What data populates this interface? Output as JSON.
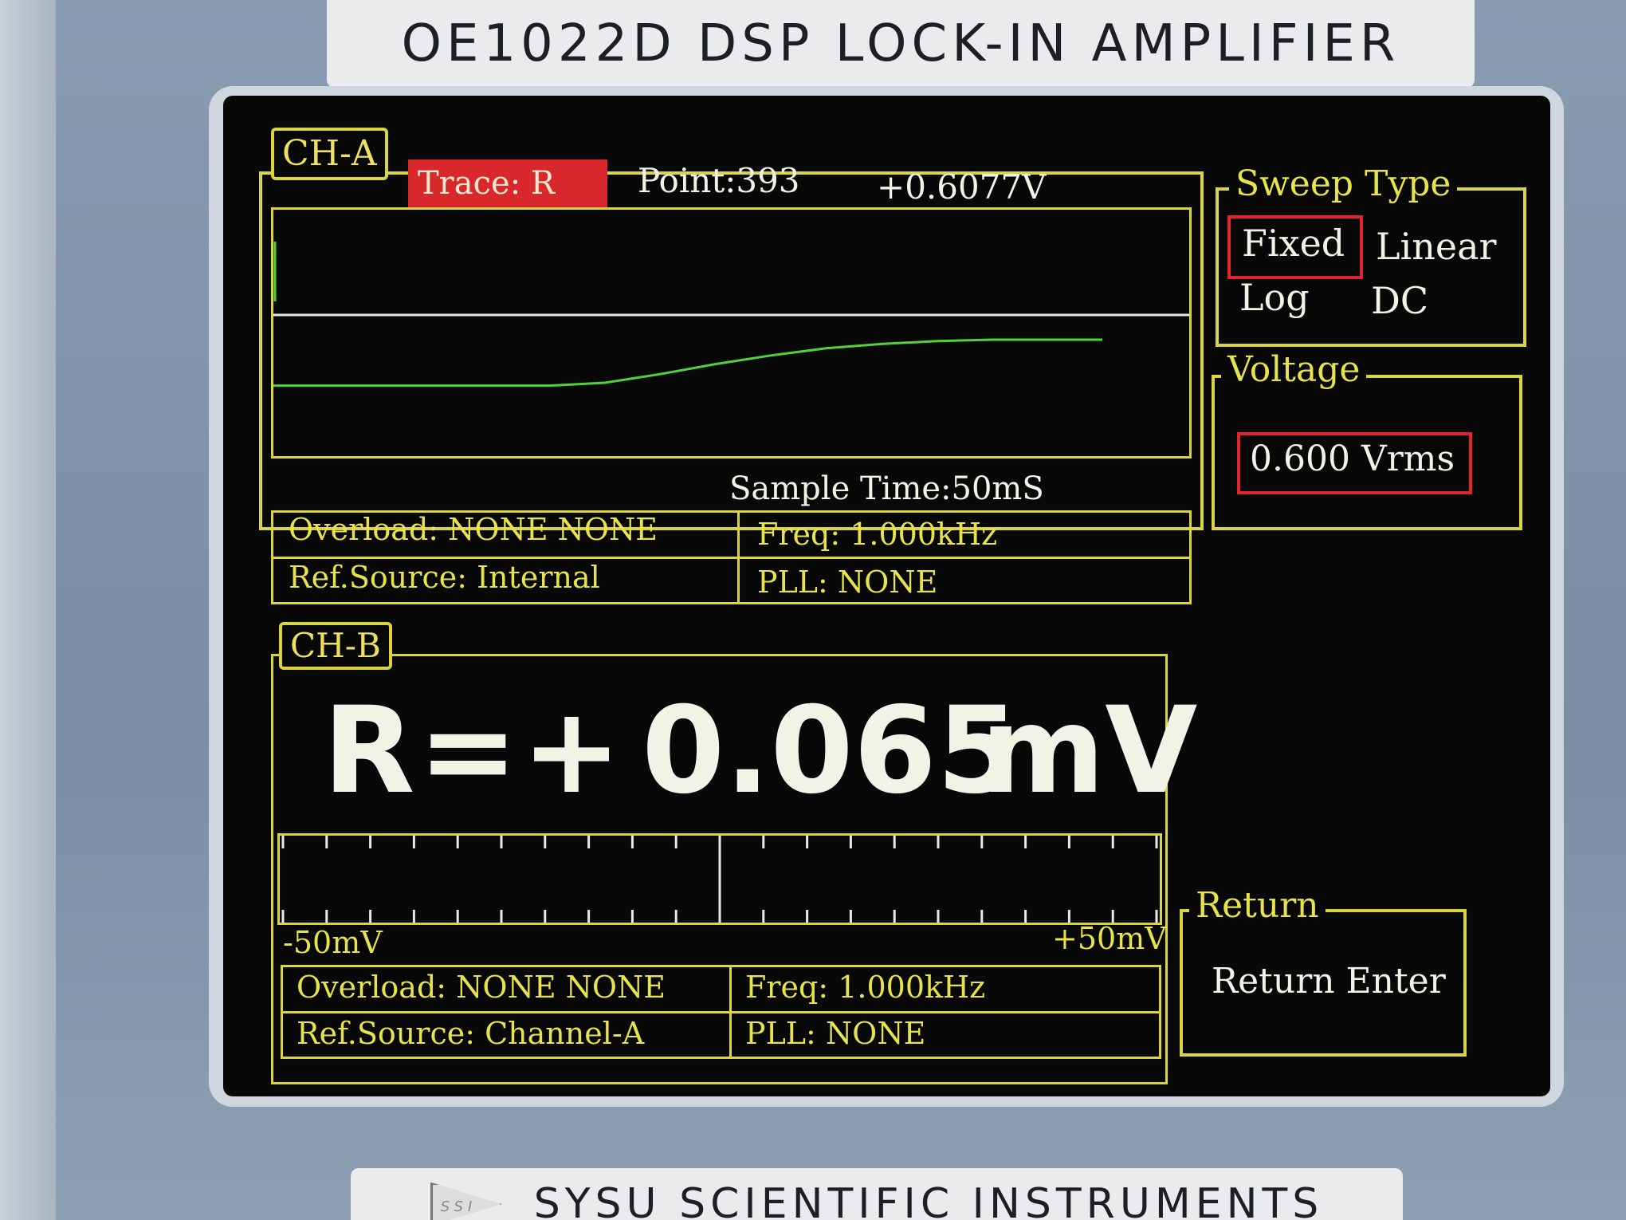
{
  "instrument": {
    "model_title": "OE1022D DSP LOCK-IN AMPLIFIER",
    "maker": "SYSU SCIENTIFIC INSTRUMENTS",
    "logo_text": "SSI"
  },
  "channel_a": {
    "label": "CH-A",
    "trace": "Trace:  R",
    "point": "Point:393",
    "value": "+0.6077V",
    "sample_time": "Sample  Time:50mS",
    "overload": "Overload:  NONE   NONE",
    "freq": "Freq: 1.000kHz",
    "ref_source": "Ref.Source: Internal",
    "pll": "PLL:  NONE"
  },
  "channel_b": {
    "label": "CH-B",
    "reading_prefix": "R=+",
    "reading_value": "0.065",
    "reading_unit": "mV",
    "scale_min": "-50mV",
    "scale_max": "+50mV",
    "overload": "Overload:  NONE   NONE",
    "freq": "Freq: 1.000kHz",
    "ref_source": "Ref.Source: Channel-A",
    "pll": "PLL:  NONE"
  },
  "sweep_type": {
    "title": "Sweep Type",
    "options": [
      "Fixed",
      "Linear",
      "Log",
      "DC"
    ],
    "selected": "Fixed"
  },
  "voltage": {
    "title": "Voltage",
    "value": "0.600 Vrms"
  },
  "return_menu": {
    "title": "Return",
    "item": "Return Enter"
  },
  "colors": {
    "frame_yellow": "#d9d440",
    "trace_green": "#4fd23a",
    "selection_red": "#e0242c",
    "screen_bg": "#070807"
  },
  "chart_data": {
    "type": "line",
    "title": "",
    "series": [
      {
        "values": [
          0.38,
          0.38,
          0.38,
          0.38,
          0.38,
          0.38,
          0.4,
          0.46,
          0.53,
          0.59,
          0.64,
          0.67,
          0.69,
          0.7,
          0.7,
          0.7
        ]
      }
    ]
  }
}
